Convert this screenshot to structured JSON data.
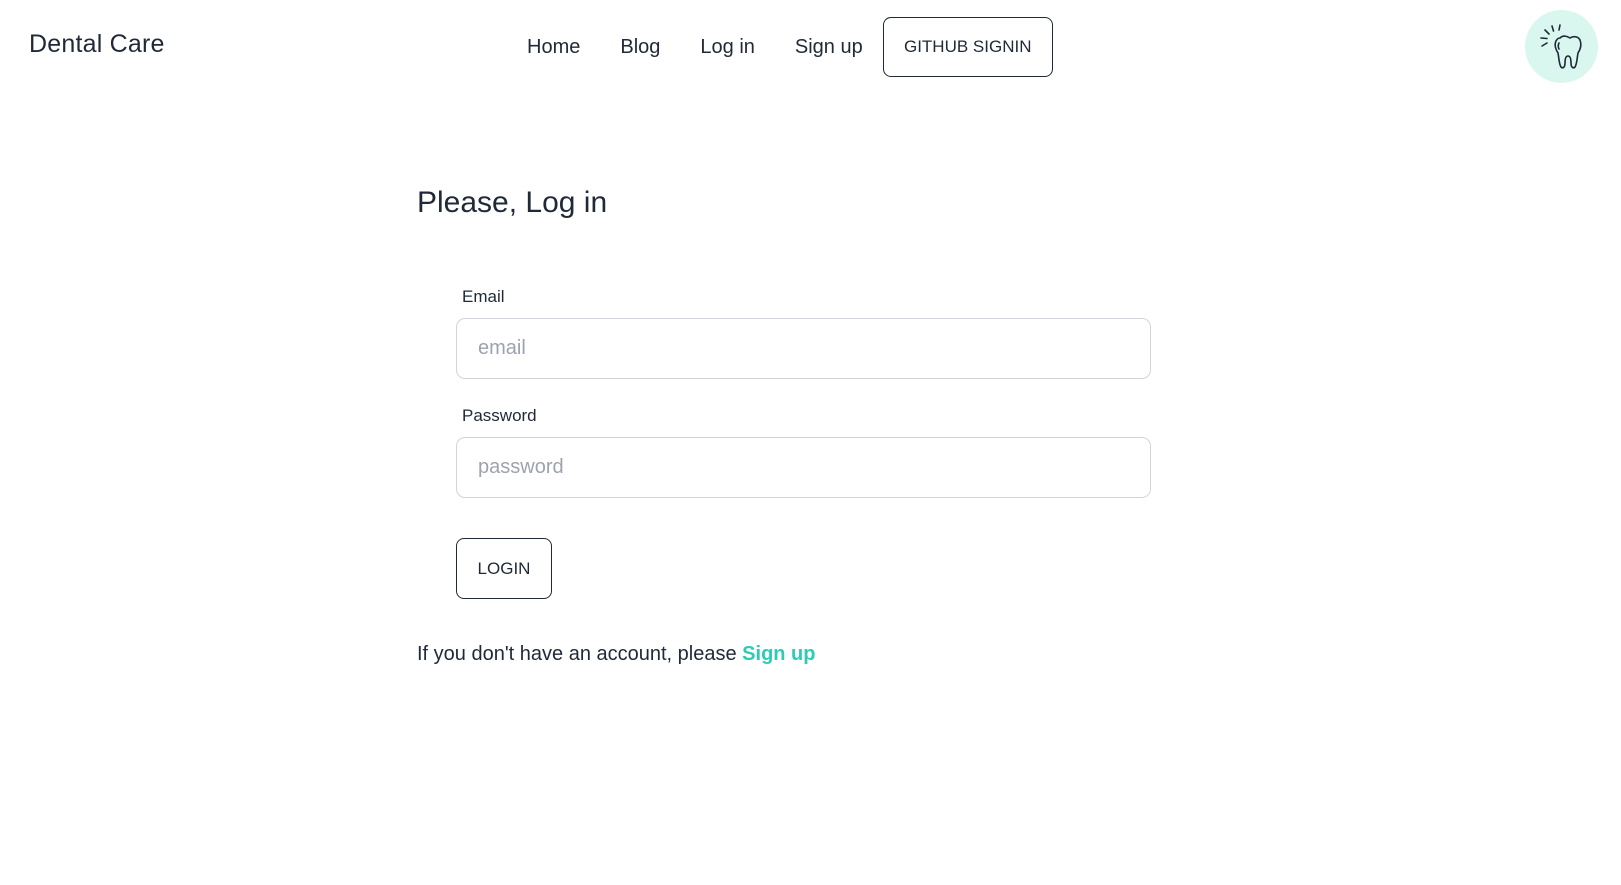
{
  "header": {
    "brand": "Dental Care",
    "nav": {
      "home": "Home",
      "blog": "Blog",
      "login": "Log in",
      "signup": "Sign up"
    },
    "github_button": "GITHUB SIGNIN",
    "avatar_icon": "tooth-icon"
  },
  "login_form": {
    "title": "Please, Log in",
    "email_label": "Email",
    "email_placeholder": "email",
    "email_value": "",
    "password_label": "Password",
    "password_placeholder": "password",
    "password_value": "",
    "submit_label": "LOGIN"
  },
  "signup_prompt": {
    "text": "If you don't have an account, please",
    "link_text": "Sign up"
  },
  "colors": {
    "accent": "#2ccdb4",
    "avatar_bg": "#d9f7ef",
    "text": "#1f2937",
    "input_border": "#d1d5db"
  }
}
